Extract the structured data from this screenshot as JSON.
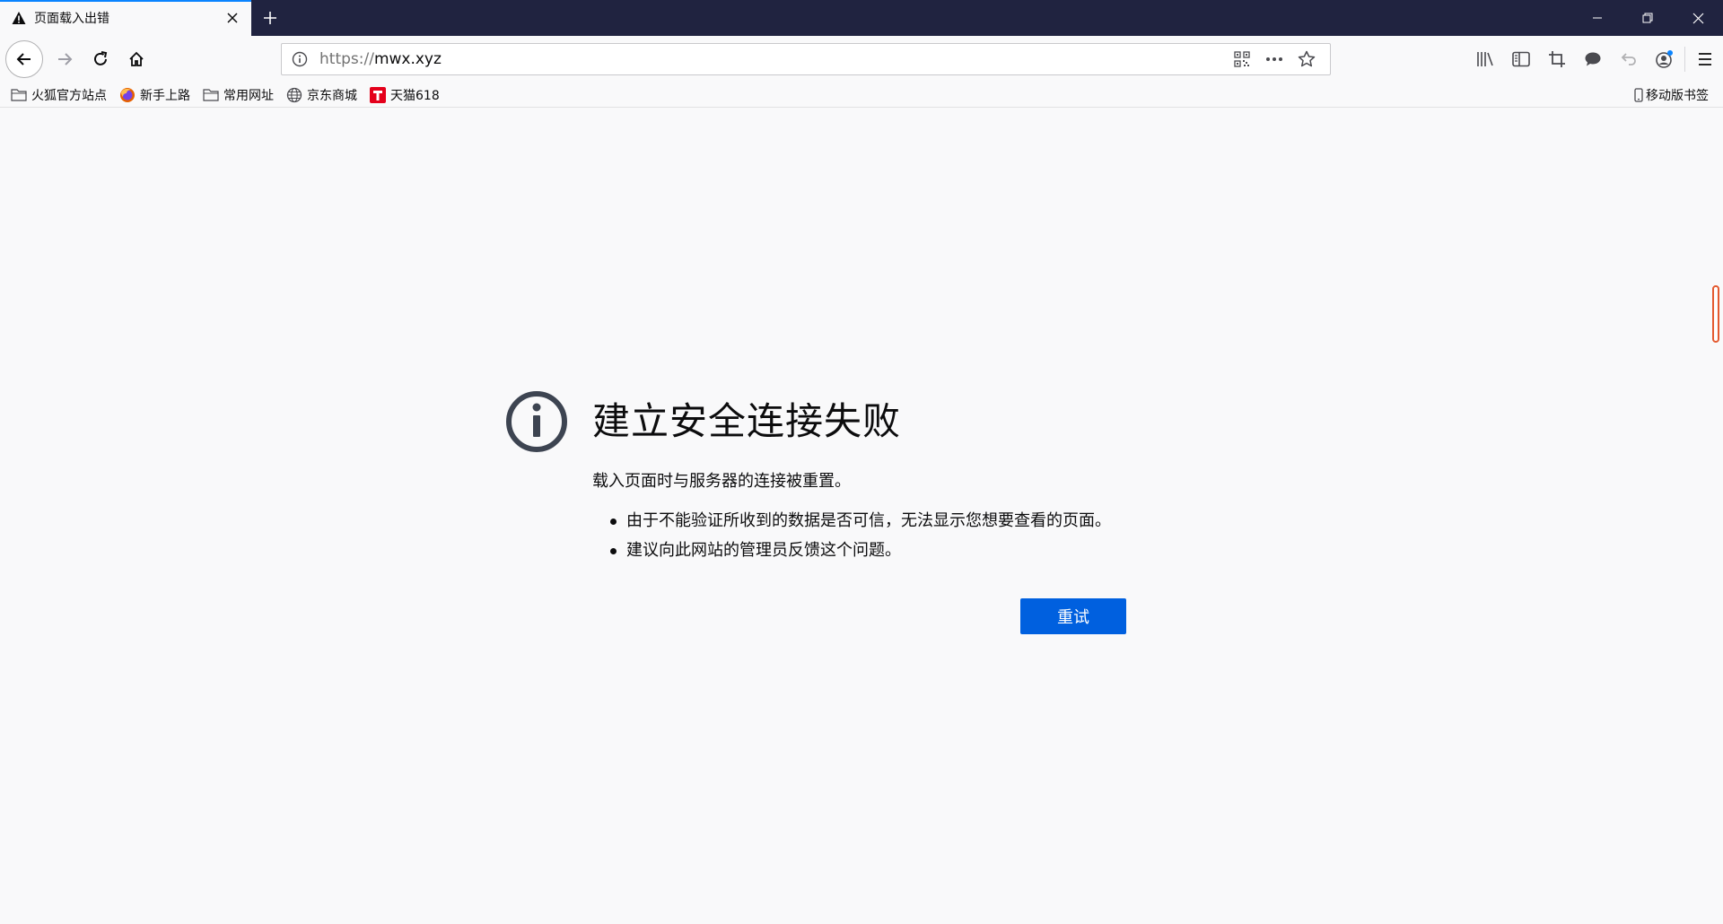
{
  "tab": {
    "title": "页面载入出错"
  },
  "navbar": {
    "url_scheme": "https://",
    "url_host": "mwx.xyz"
  },
  "bookmarks": [
    {
      "label": "火狐官方站点",
      "icon": "folder-icon"
    },
    {
      "label": "新手上路",
      "icon": "firefox-icon"
    },
    {
      "label": "常用网址",
      "icon": "folder-icon"
    },
    {
      "label": "京东商城",
      "icon": "globe-icon"
    },
    {
      "label": "天猫618",
      "icon": "tmall-icon"
    }
  ],
  "mobile_bookmarks": {
    "label": "移动版书签"
  },
  "error": {
    "title": "建立安全连接失败",
    "description": "载入页面时与服务器的连接被重置。",
    "items": [
      "由于不能验证所收到的数据是否可信，无法显示您想要查看的页面。",
      "建议向此网站的管理员反馈这个问题。"
    ],
    "retry_label": "重试"
  },
  "colors": {
    "accent": "#0060df",
    "titlebar": "#202340",
    "tab_highlight": "#0a84ff"
  }
}
